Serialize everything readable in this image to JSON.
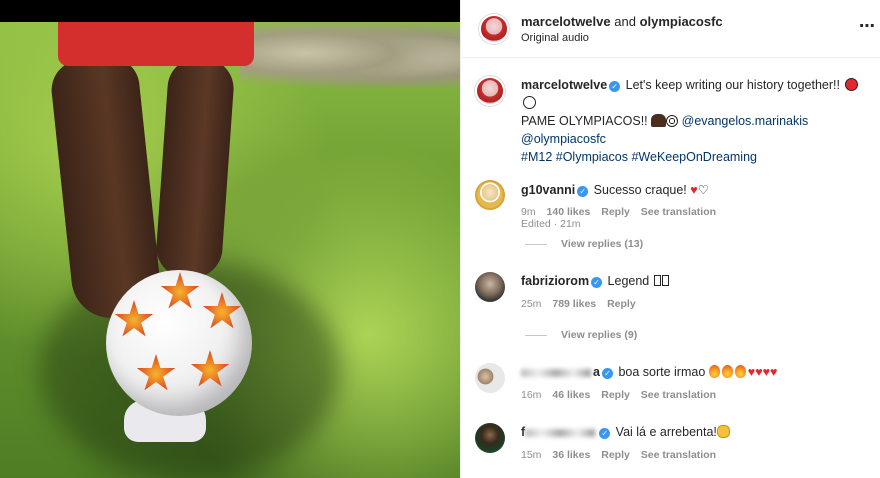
{
  "header": {
    "user1": "marcelotwelve",
    "conjunction": "and",
    "user2": "olympiacosfc",
    "subtitle": "Original audio",
    "more_icon": "more-icon"
  },
  "caption": {
    "username": "marcelotwelve",
    "text_line1": "Let's keep writing our history together!!",
    "text_line2": "PAME OLYMPIACOS!!",
    "mention1": "@evangelos.marinakis",
    "mention2": "@olympiacosfc",
    "hashtags": "#M12 #Olympiacos #WeKeepOnDreaming",
    "meta": "Edited · 21m"
  },
  "comments": [
    {
      "username": "g10vanni",
      "text": "Sucesso craque!",
      "time": "9m",
      "likes": "140 likes",
      "reply": "Reply",
      "translate": "See translation"
    },
    {
      "username": "fabriziorom",
      "text": "Legend",
      "time": "25m",
      "likes": "789 likes",
      "reply": "Reply"
    },
    {
      "username_suffix": "a",
      "text": "boa sorte irmao",
      "time": "16m",
      "likes": "46 likes",
      "reply": "Reply",
      "translate": "See translation"
    },
    {
      "username_prefix": "f",
      "text": "Vai lá e arrebenta!",
      "time": "15m",
      "likes": "36 likes",
      "reply": "Reply",
      "translate": "See translation"
    }
  ],
  "view_replies": [
    "View replies (13)",
    "View replies (9)"
  ],
  "colors": {
    "verified": "#3897f0",
    "link": "#00376b",
    "muted": "#8e8e8e",
    "heart": "#e3262f"
  }
}
